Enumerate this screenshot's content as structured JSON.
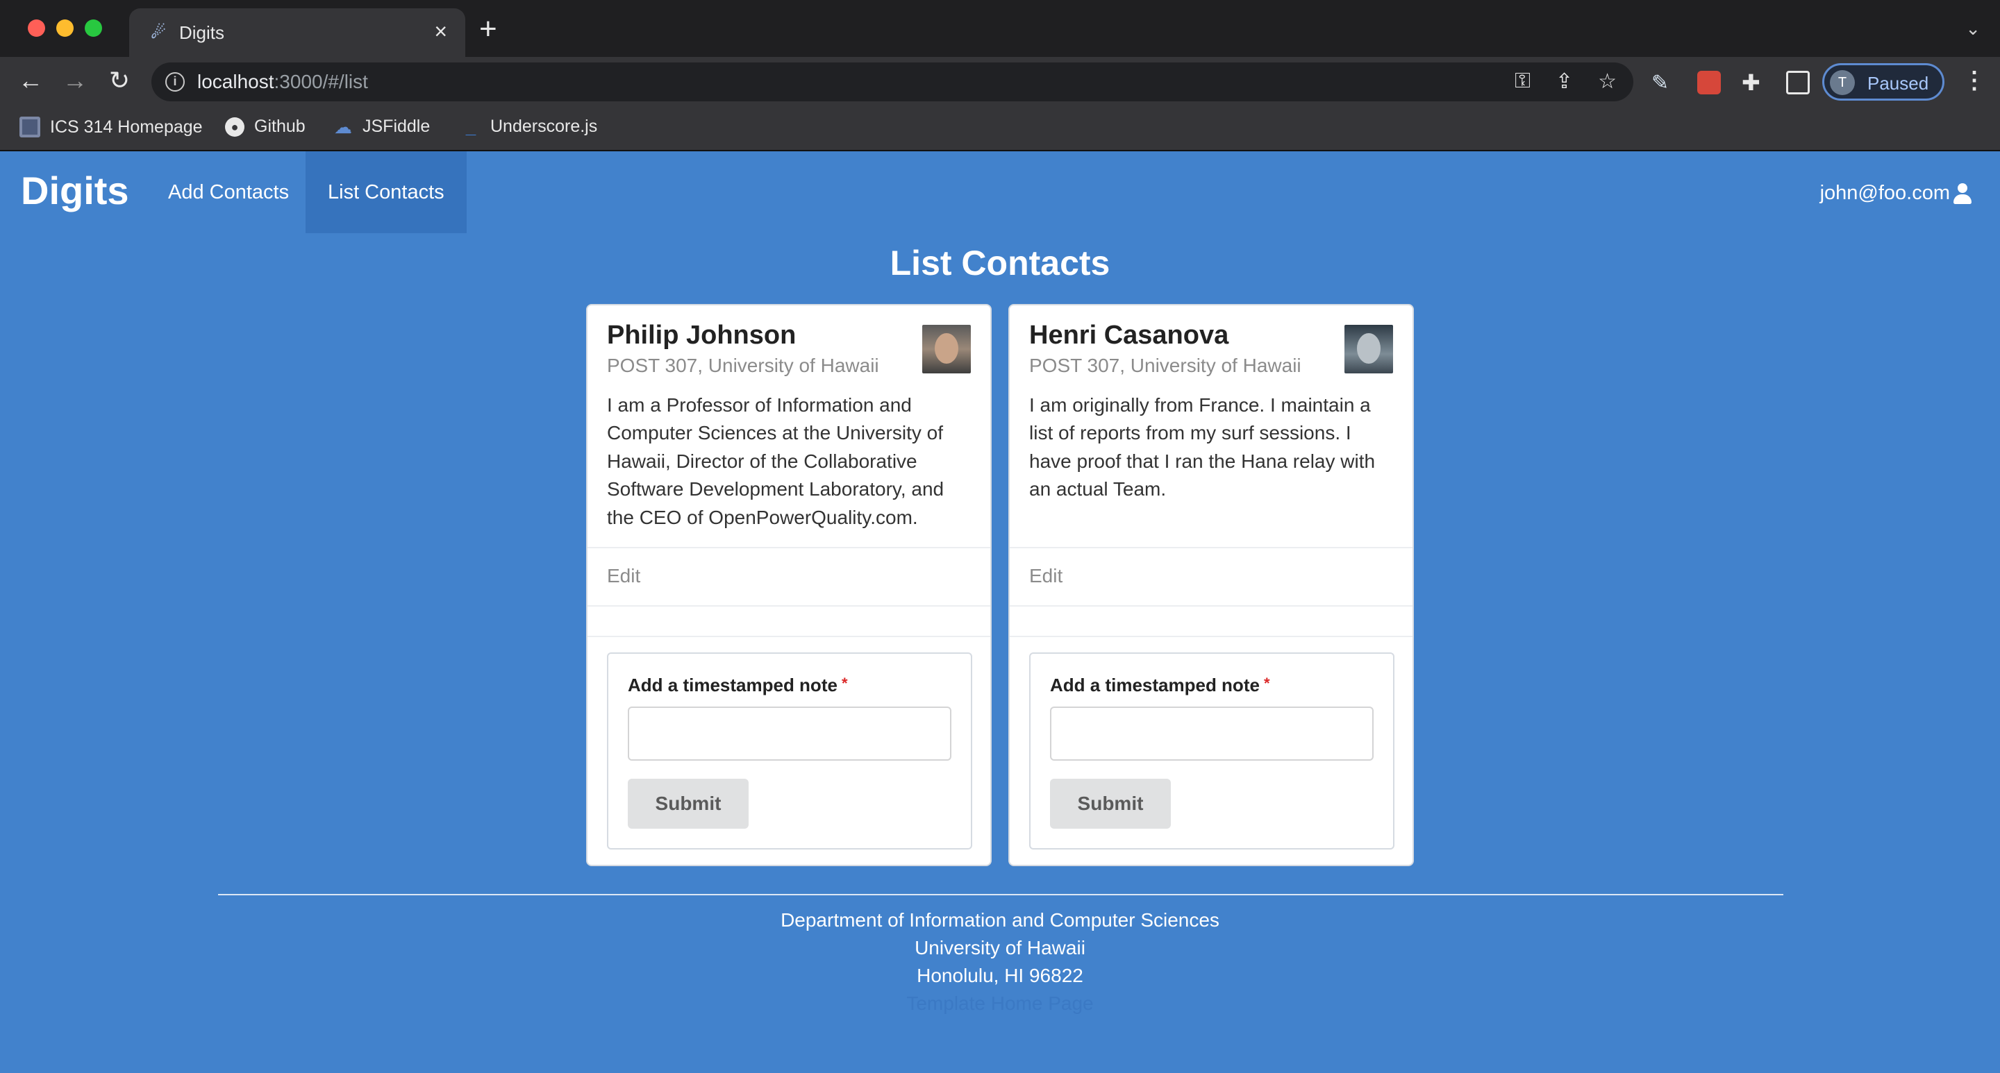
{
  "browser": {
    "tab_title": "Digits",
    "url_host": "localhost",
    "url_path": ":3000/#/list",
    "profile_initial": "T",
    "profile_status": "Paused",
    "bookmarks": [
      {
        "label": "ICS 314 Homepage"
      },
      {
        "label": "Github"
      },
      {
        "label": "JSFiddle"
      },
      {
        "label": "Underscore.js"
      }
    ]
  },
  "navbar": {
    "brand": "Digits",
    "links": [
      {
        "label": "Add Contacts"
      },
      {
        "label": "List Contacts"
      }
    ],
    "user": "john@foo.com"
  },
  "page": {
    "title": "List Contacts"
  },
  "contacts": [
    {
      "name": "Philip Johnson",
      "address": "POST 307, University of Hawaii",
      "description": "I am a Professor of Information and Computer Sciences at the University of Hawaii, Director of the Collaborative Software Development Laboratory, and the CEO of OpenPowerQuality.com.",
      "edit_label": "Edit",
      "note_label": "Add a timestamped note",
      "required_mark": "*",
      "submit_label": "Submit"
    },
    {
      "name": "Henri Casanova",
      "address": "POST 307, University of Hawaii",
      "description": "I am originally from France. I maintain a list of reports from my surf sessions. I have proof that I ran the Hana relay with an actual Team.",
      "edit_label": "Edit",
      "note_label": "Add a timestamped note",
      "required_mark": "*",
      "submit_label": "Submit"
    }
  ],
  "footer": {
    "line1": "Department of Information and Computer Sciences",
    "line2": "University of Hawaii",
    "line3": "Honolulu, HI 96822",
    "line4": "Template Home Page"
  },
  "colors": {
    "app_background": "#4282cc",
    "active_nav": "#3673bd",
    "required": "#db2828"
  }
}
